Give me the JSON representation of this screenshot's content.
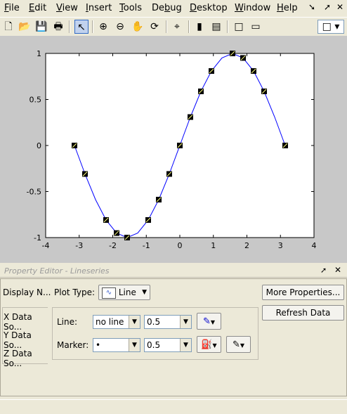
{
  "menu": {
    "items": [
      {
        "label": "File",
        "u": "F"
      },
      {
        "label": "Edit",
        "u": "E"
      },
      {
        "label": "View",
        "u": "V"
      },
      {
        "label": "Insert",
        "u": "I"
      },
      {
        "label": "Tools",
        "u": "T"
      },
      {
        "label": "Debug",
        "u": "b"
      },
      {
        "label": "Desktop",
        "u": "D"
      },
      {
        "label": "Window",
        "u": "W"
      },
      {
        "label": "Help",
        "u": "H"
      }
    ]
  },
  "toolbar": {
    "icons": [
      "new-file-icon",
      "open-folder-icon",
      "save-icon",
      "print-icon",
      "pointer-icon",
      "zoom-in-icon",
      "zoom-out-icon",
      "pan-hand-icon",
      "rotate-3d-icon",
      "data-cursor-icon",
      "colorbar-icon",
      "legend-icon",
      "hide-plot-tools-icon",
      "show-plot-tools-icon"
    ]
  },
  "chart_data": {
    "type": "line",
    "title": "",
    "xlabel": "",
    "ylabel": "",
    "xlim": [
      -4,
      4
    ],
    "ylim": [
      -1,
      1
    ],
    "xticks": [
      "-4",
      "-3",
      "-2",
      "-1",
      "0",
      "1",
      "2",
      "3",
      "4"
    ],
    "yticks": [
      "-1",
      "-0.5",
      "0",
      "0.5",
      "1"
    ],
    "grid": false,
    "line_color": "#0000ff",
    "series": [
      {
        "x": [
          -3.1416,
          -2.8274,
          -2.5133,
          -2.1991,
          -1.885,
          -1.5708,
          -1.2566,
          -0.9425,
          -0.6283,
          -0.3142,
          0,
          0.3142,
          0.6283,
          0.9425,
          1.2566,
          1.5708,
          1.885,
          2.1991,
          2.5133,
          2.8274,
          3.1416
        ],
        "y": [
          0,
          -0.309,
          -0.588,
          -0.809,
          -0.951,
          -1,
          -0.951,
          -0.809,
          -0.588,
          -0.309,
          0,
          0.309,
          0.588,
          0.809,
          0.951,
          1,
          0.951,
          0.809,
          0.588,
          0.309,
          0
        ],
        "marker_x": [
          -3.1416,
          -2.8274,
          -2.1991,
          -1.885,
          -1.5708,
          -0.9425,
          -0.6283,
          -0.3142,
          0,
          0.3142,
          0.6283,
          0.9425,
          1.5708,
          1.885,
          2.1991,
          2.5133,
          3.1416
        ],
        "marker_y": [
          0,
          -0.309,
          -0.809,
          -0.951,
          -1,
          -0.809,
          -0.588,
          -0.309,
          0,
          0.309,
          0.588,
          0.809,
          1,
          0.951,
          0.809,
          0.588,
          0
        ]
      }
    ]
  },
  "property_editor": {
    "title": "Property Editor - Lineseries",
    "display_name_label": "Display N...",
    "plot_type_label": "Plot Type:",
    "plot_type_value": "Line",
    "x_data_label": "X Data So...",
    "y_data_label": "Y Data So...",
    "z_data_label": "Z Data So...",
    "line_label": "Line:",
    "line_style": "no line",
    "line_width": "0.5",
    "marker_label": "Marker:",
    "marker_style": "•",
    "marker_size": "0.5",
    "more_properties": "More Properties...",
    "refresh_data": "Refresh Data"
  }
}
